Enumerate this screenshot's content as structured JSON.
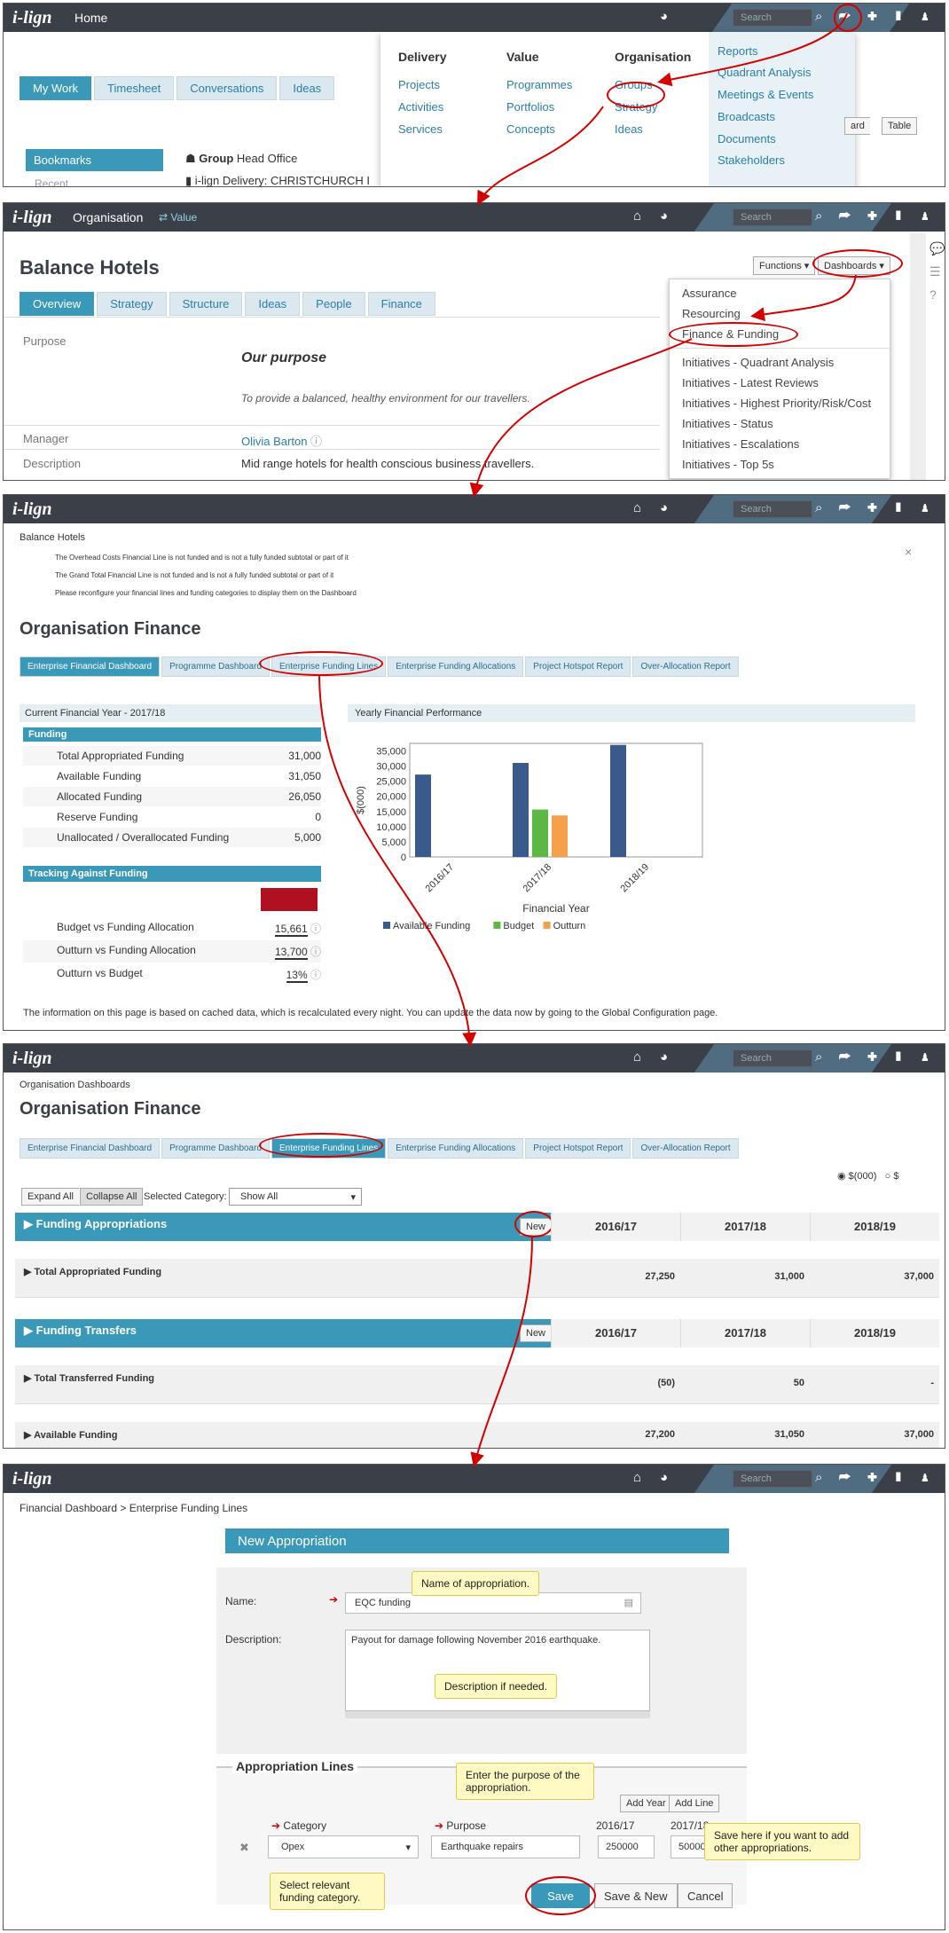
{
  "brand": "i-lign",
  "search_placeholder": "Search",
  "p1": {
    "title": "Home",
    "tabs": [
      "My Work",
      "Timesheet",
      "Conversations",
      "Ideas"
    ],
    "bookmarks": "Bookmarks",
    "recent": "Recent",
    "group_label": "Group",
    "group_name": "Head Office",
    "delivery_item": "i-lign Delivery: CHRISTCHURCH I",
    "menu": {
      "col1": {
        "h": "Delivery",
        "items": [
          "Projects",
          "Activities",
          "Services"
        ]
      },
      "col2": {
        "h": "Value",
        "items": [
          "Programmes",
          "Portfolios",
          "Concepts"
        ]
      },
      "col3": {
        "h": "Organisation",
        "items": [
          "Groups",
          "Strategy",
          "Ideas"
        ]
      },
      "col4": [
        "Reports",
        "Quadrant Analysis",
        "Meetings & Events",
        "Broadcasts",
        "Documents",
        "Stakeholders"
      ]
    },
    "view_btns": [
      "ard",
      "Table"
    ]
  },
  "p2": {
    "title": "Organisation",
    "value_link": "Value",
    "heading": "Balance Hotels",
    "tabs": [
      "Overview",
      "Strategy",
      "Structure",
      "Ideas",
      "People",
      "Finance"
    ],
    "functions": "Functions",
    "dashboards": "Dashboards",
    "dd": [
      "Assurance",
      "Resourcing",
      "Finance & Funding",
      "Initiatives - Quadrant Analysis",
      "Initiatives - Latest Reviews",
      "Initiatives - Highest Priority/Risk/Cost",
      "Initiatives - Status",
      "Initiatives - Escalations",
      "Initiatives - Top 5s"
    ],
    "purpose_lbl": "Purpose",
    "purpose_h": "Our purpose",
    "purpose_t": "To provide a balanced, healthy environment for our travellers.",
    "manager_lbl": "Manager",
    "manager": "Olivia Barton",
    "desc_lbl": "Description",
    "desc": "Mid range hotels for health conscious business travellers."
  },
  "p3": {
    "crumb": "Balance Hotels",
    "msgs": [
      "The Overhead Costs Financial Line is not funded and is not a fully funded subtotal or part of it",
      "The Grand Total Financial Line is not funded and is not a fully funded subtotal or part of it",
      "Please reconfigure your financial lines and funding categories to display them on the Dashboard"
    ],
    "close": "×",
    "heading": "Organisation Finance",
    "tabs": [
      "Enterprise Financial Dashboard",
      "Programme Dashboard",
      "Enterprise Funding Lines",
      "Enterprise Funding Allocations",
      "Project Hotspot Report",
      "Over-Allocation Report"
    ],
    "cfy": "Current Financial Year - 2017/18",
    "funding_h": "Funding",
    "funding": [
      [
        "Total Appropriated Funding",
        "31,000"
      ],
      [
        "Available Funding",
        "31,050"
      ],
      [
        "Allocated Funding",
        "26,050"
      ],
      [
        "Reserve Funding",
        "0"
      ],
      [
        "Unallocated / Overallocated Funding",
        "5,000"
      ]
    ],
    "tracking_h": "Tracking Against Funding",
    "tracking": [
      [
        "Budget vs Funding Allocation",
        "15,661"
      ],
      [
        "Outturn vs Funding Allocation",
        "13,700"
      ],
      [
        "Outturn vs Budget",
        "13%"
      ]
    ],
    "yfp": "Yearly Financial Performance",
    "note": "The information on this page is based on cached data, which is recalculated every night. You can update the data now by going to the Global Configuration page."
  },
  "chart_data": {
    "type": "bar",
    "categories": [
      "2016/17",
      "2017/18",
      "2018/19"
    ],
    "series": [
      {
        "name": "Available Funding",
        "values": [
          27200,
          31050,
          37000
        ],
        "color": "#3a5a8c"
      },
      {
        "name": "Budget",
        "values": [
          null,
          15661,
          null
        ],
        "color": "#5bb844"
      },
      {
        "name": "Outturn",
        "values": [
          null,
          13700,
          null
        ],
        "color": "#f5a04a"
      }
    ],
    "xlabel": "Financial Year",
    "ylabel": "$(000)",
    "ylim": [
      0,
      37500
    ],
    "yticks": [
      "0",
      "5,000",
      "10,000",
      "15,000",
      "20,000",
      "25,000",
      "30,000",
      "35,000"
    ],
    "legend": "bottom"
  },
  "p4": {
    "crumb": "Organisation Dashboards",
    "heading": "Organisation Finance",
    "units": [
      "$(000)",
      "$"
    ],
    "expand": "Expand All",
    "collapse": "Collapse All",
    "selcat": "Selected Category:",
    "showall": "Show All",
    "years": [
      "2016/17",
      "2017/18",
      "2018/19"
    ],
    "new": "New",
    "fa": "Funding Appropriations",
    "taf": "Total Appropriated Funding",
    "taf_v": [
      "27,250",
      "31,000",
      "37,000"
    ],
    "ft": "Funding Transfers",
    "ttf": "Total Transferred Funding",
    "ttf_v": [
      "(50)",
      "50",
      "-"
    ],
    "af": "Available Funding",
    "af_v": [
      "27,200",
      "31,050",
      "37,000"
    ]
  },
  "p5": {
    "crumb": "Financial Dashboard > Enterprise Funding Lines",
    "form_h": "New Appropriation",
    "name_lbl": "Name:",
    "name_val": "EQC funding",
    "desc_lbl": "Description:",
    "desc_val": "Payout for damage following November 2016 earthquake.",
    "lines_h": "Appropriation Lines",
    "add_year": "Add Year",
    "add_line": "Add Line",
    "cat_lbl": "Category",
    "pur_lbl": "Purpose",
    "y1": "2016/17",
    "y2": "2017/18",
    "cat_val": "Opex",
    "pur_val": "Earthquake repairs",
    "v1": "250000",
    "v2": "50000",
    "save": "Save",
    "save_new": "Save & New",
    "cancel": "Cancel",
    "c_name": "Name of  appropriation.",
    "c_desc": "Description if needed.",
    "c_purpose": "Enter the purpose of the appropriation.",
    "c_cat": "Select relevant funding category.",
    "c_save": "Save here if you want to add other appropriations."
  }
}
